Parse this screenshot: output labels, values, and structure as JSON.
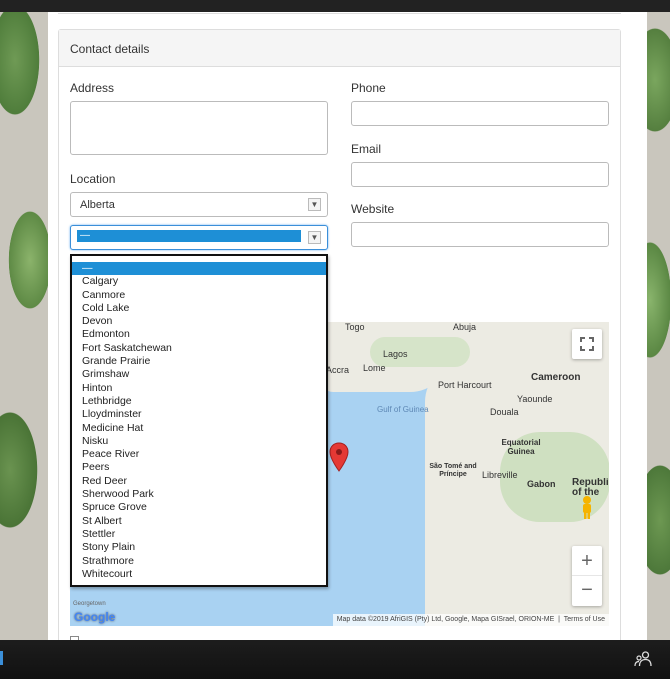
{
  "card": {
    "title": "Contact details"
  },
  "form": {
    "address_label": "Address",
    "address_value": "",
    "location_label": "Location",
    "location_value": "Alberta",
    "city_value": "—",
    "phone_label": "Phone",
    "phone_value": "",
    "email_label": "Email",
    "email_value": "",
    "website_label": "Website",
    "website_value": ""
  },
  "city_dropdown": {
    "selected": "—",
    "options": [
      "Calgary",
      "Canmore",
      "Cold Lake",
      "Devon",
      "Edmonton",
      "Fort Saskatchewan",
      "Grande Prairie",
      "Grimshaw",
      "Hinton",
      "Lethbridge",
      "Lloydminster",
      "Medicine Hat",
      "Nisku",
      "Peace River",
      "Peers",
      "Red Deer",
      "Sherwood Park",
      "Spruce Grove",
      "St Albert",
      "Stettler",
      "Stony Plain",
      "Strathmore",
      "Whitecourt"
    ]
  },
  "map": {
    "places": [
      "Togo",
      "Abuja",
      "Lagos",
      "Accra",
      "Lome",
      "Port Harcourt",
      "Cameroon",
      "Gulf of Guinea",
      "Yaounde",
      "Douala",
      "Equatorial Guinea",
      "São Tomé and Príncipe",
      "Libreville",
      "Gabon",
      "Republic of the Congo",
      "Georgetown"
    ],
    "attribution": "Map data ©2019 AfriGIS (Pty) Ltd, Google, Mapa GISrael, ORION-ME",
    "terms": "Terms of Use",
    "logo": "Google",
    "zoom_in": "+",
    "zoom_out": "−",
    "fullscreen_icon": "fullscreen-icon",
    "pegman_icon": "pegman-icon",
    "marker_color": "#e53935"
  },
  "colors": {
    "accent": "#1e8fd6",
    "sea": "#a9d2f2",
    "land": "#ecebe3"
  }
}
